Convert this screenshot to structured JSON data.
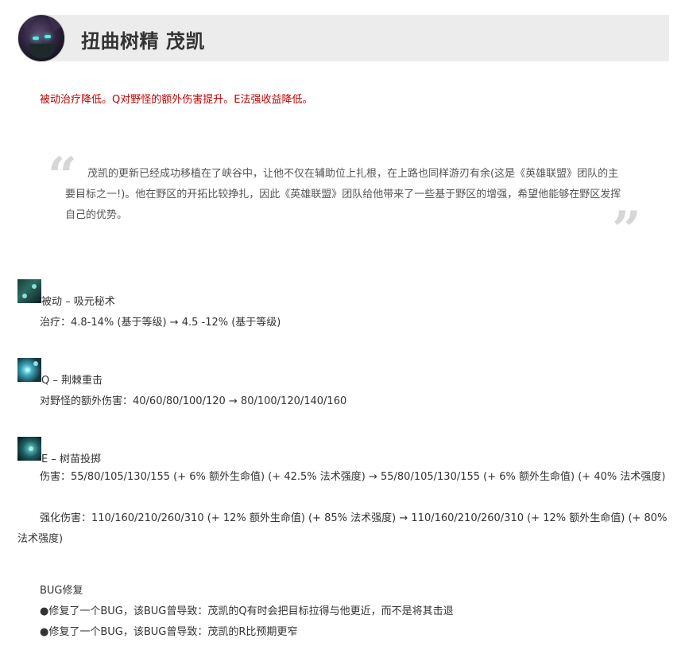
{
  "header": {
    "title": "扭曲树精 茂凯",
    "avatar_icon": "maokai-portrait-icon"
  },
  "summary": "被动治疗降低。Q对野怪的额外伤害提升。E法强收益降低。",
  "quote": {
    "open_mark": "“",
    "close_mark": "”",
    "text": "茂凯的更新已经成功移植在了峡谷中，让他不仅在辅助位上扎根，在上路也同样游刃有余(这是《英雄联盟》团队的主要目标之一!)。他在野区的开拓比较挣扎，因此《英雄联盟》团队给他带来了一些基于野区的增强，希望他能够在野区发挥自己的优势。"
  },
  "skills": {
    "passive": {
      "icon": "passive-sap-magic-icon",
      "title": "被动 – 吸元秘术",
      "lines": [
        "治疗：4.8-14% (基于等级) → 4.5 -12% (基于等级)"
      ]
    },
    "q": {
      "icon": "q-bramble-smash-icon",
      "title": "Q – 荆棘重击",
      "lines": [
        "对野怪的额外伤害：40/60/80/100/120 → 80/100/120/140/160"
      ]
    },
    "e": {
      "icon": "e-sapling-toss-icon",
      "title": "E – 树苗投掷",
      "lines": [
        "伤害：55/80/105/130/155 (+ 6% 额外生命值) (+ 42.5% 法术强度) → 55/80/105/130/155 (+ 6% 额外生命值) (+ 40% 法术强度)",
        "强化伤害：110/160/210/260/310 (+ 12% 额外生命值) (+ 85% 法术强度) → 110/160/210/260/310 (+ 12% 额外生命值) (+ 80% 法术强度)"
      ]
    }
  },
  "bugfix": {
    "title": "BUG修复",
    "items": [
      "●修复了一个BUG，该BUG曾导致：茂凯的Q有时会把目标拉得与他更近，而不是将其击退",
      "●修复了一个BUG，该BUG曾导致：茂凯的R比预期更窄"
    ]
  },
  "colors": {
    "summary_red": "#c00000",
    "header_bg": "#ececec",
    "quote_mark": "#d6d6d6"
  }
}
